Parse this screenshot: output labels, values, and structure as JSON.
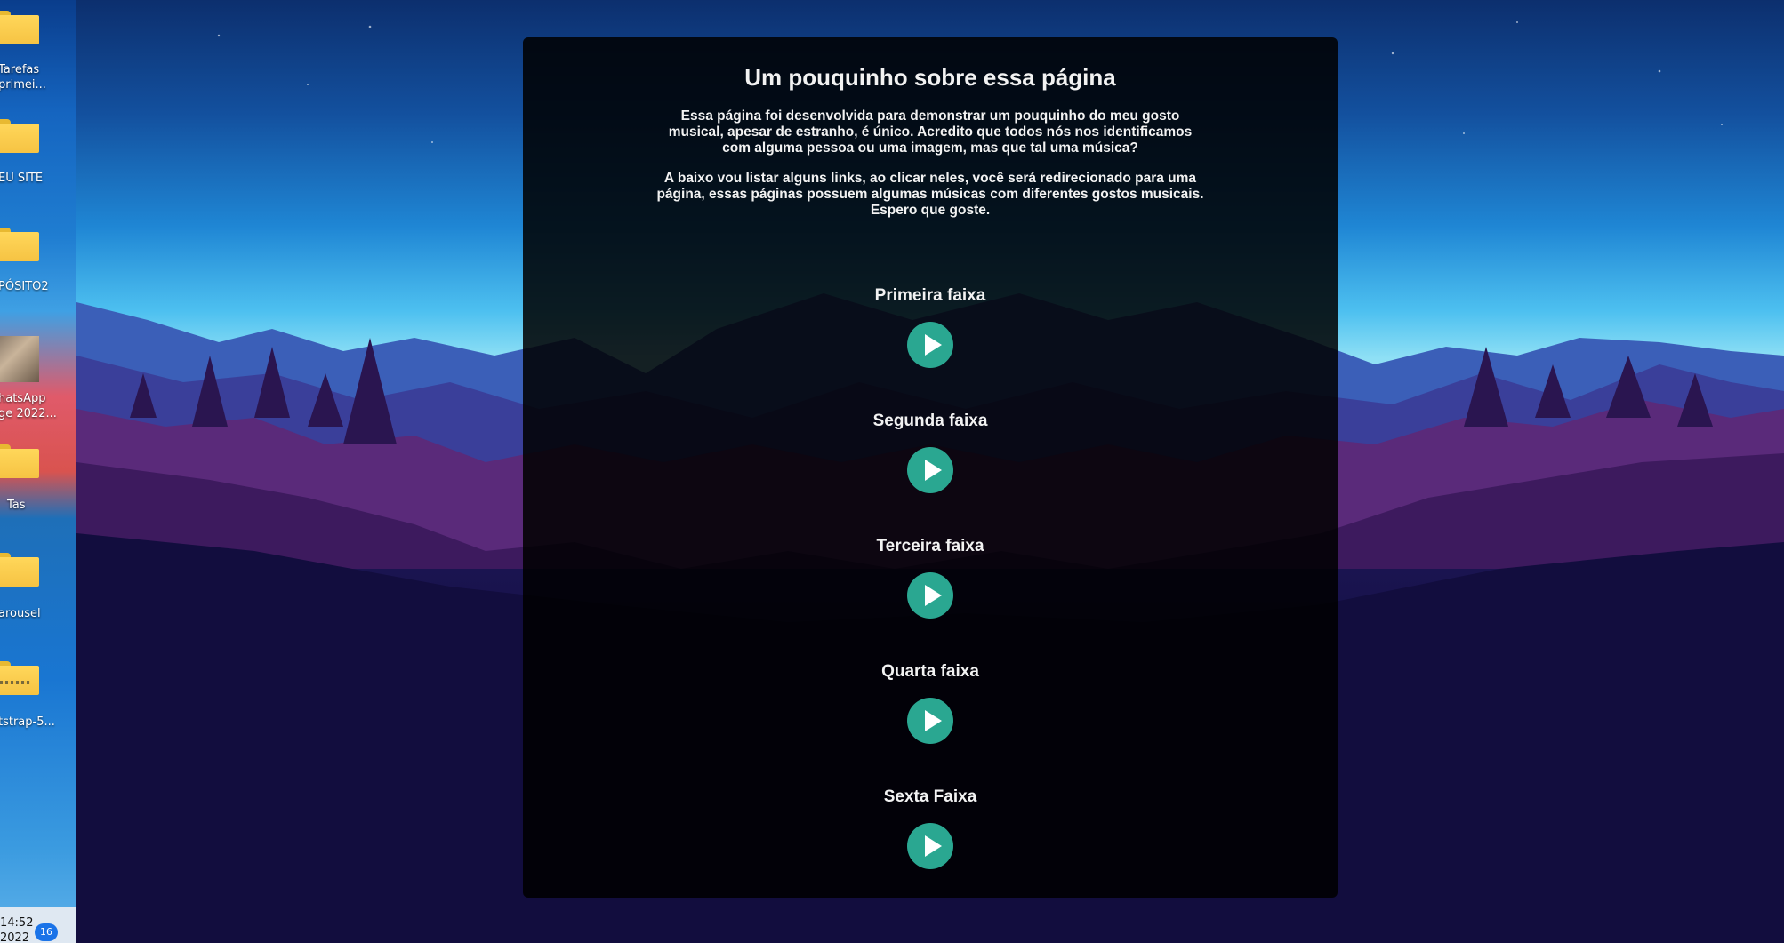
{
  "desktop": {
    "icons": [
      {
        "label_line1": "Tarefas",
        "label_line2": "primei...",
        "icon": "folder-icon"
      },
      {
        "label_line1": "EU SITE",
        "label_line2": "",
        "icon": "folder-icon"
      },
      {
        "label_line1": "PÓSITO2",
        "label_line2": "",
        "icon": "folder-icon"
      },
      {
        "label_line1": "hatsApp",
        "label_line2": "ge 2022...",
        "icon": "image-thumbnail-icon"
      },
      {
        "label_line1": "Tas",
        "label_line2": "",
        "icon": "folder-icon"
      },
      {
        "label_line1": "arousel",
        "label_line2": "",
        "icon": "folder-icon"
      },
      {
        "label_line1": "tstrap-5...",
        "label_line2": "",
        "icon": "zip-folder-icon"
      }
    ],
    "taskbar": {
      "time": "14:52",
      "date": "2022",
      "notification_count": "16"
    }
  },
  "page": {
    "title": "Um pouquinho sobre essa página",
    "intro_paragraph_1": "Essa página foi desenvolvida para demonstrar um pouquinho do meu gosto musical, apesar de estranho, é único. Acredito que todos nós nos identificamos com alguma pessoa ou uma imagem, mas que tal uma música?",
    "intro_paragraph_2": "A baixo vou listar alguns links, ao clicar neles, você será redirecionado para uma página, essas páginas possuem algumas músicas com diferentes gostos musicais. Espero que goste.",
    "tracks": [
      {
        "title": "Primeira faixa",
        "icon": "play-icon"
      },
      {
        "title": "Segunda faixa",
        "icon": "play-icon"
      },
      {
        "title": "Terceira faixa",
        "icon": "play-icon"
      },
      {
        "title": "Quarta faixa",
        "icon": "play-icon"
      },
      {
        "title": "Sexta Faixa",
        "icon": "play-icon"
      }
    ]
  },
  "colors": {
    "play_button": "#2aa791",
    "card_background": "rgba(0,0,0,0.86)",
    "text": "#f2f2f2"
  }
}
